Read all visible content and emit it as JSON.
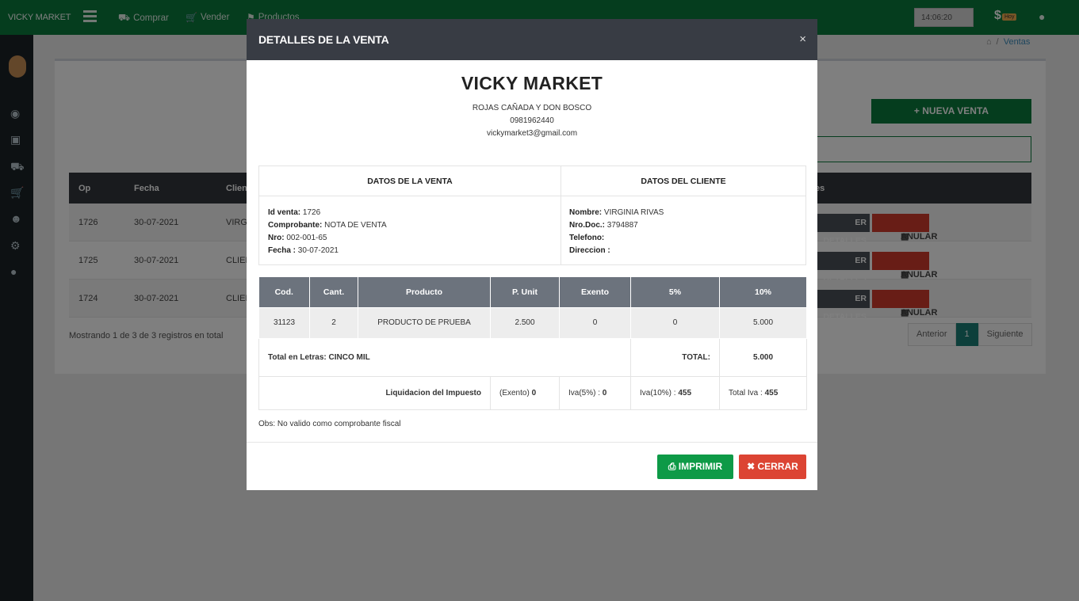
{
  "topbar": {
    "brand": "VICKY MARKET",
    "nav": [
      "Comprar",
      "Vender",
      "Productos"
    ],
    "clock": "14:06:20",
    "money_symbol": "$",
    "hoy": "Hoy"
  },
  "breadcrumb": {
    "current": "Ventas",
    "separator": "/"
  },
  "page": {
    "new_button": "NUEVA VENTA",
    "columns": [
      "Op",
      "Fecha",
      "Clien",
      "es"
    ],
    "rows": [
      {
        "op": "1726",
        "fecha": "30-07-2021",
        "cliente": "VIRGI"
      },
      {
        "op": "1725",
        "fecha": "30-07-2021",
        "cliente": "CLIEN"
      },
      {
        "op": "1724",
        "fecha": "30-07-2021",
        "cliente": "CLIEN"
      }
    ],
    "ver_label": "ER DETALLES",
    "anular_label": "ANULAR",
    "showing": "Mostrando 1 de 3 de 3 registros en total",
    "pager": {
      "prev": "Anterior",
      "page": "1",
      "next": "Siguiente"
    }
  },
  "modal": {
    "title": "DETALLES DE LA VENTA",
    "close": "×",
    "store": {
      "name": "VICKY MARKET",
      "address": "ROJAS CAÑADA Y DON BOSCO",
      "phone": "0981962440",
      "email": "vickymarket3@gmail.com"
    },
    "sale": {
      "heading": "DATOS DE LA VENTA",
      "id_label": "Id venta:",
      "id": "1726",
      "comp_label": "Comprobante:",
      "comp": "NOTA DE VENTA",
      "nro_label": "Nro:",
      "nro": "002-001-65",
      "fecha_label": "Fecha :",
      "fecha": "30-07-2021"
    },
    "client": {
      "heading": "DATOS DEL CLIENTE",
      "nombre_label": "Nombre:",
      "nombre": "VIRGINIA RIVAS",
      "doc_label": "Nro.Doc.:",
      "doc": "3794887",
      "tel_label": "Telefono:",
      "tel": "",
      "dir_label": "Direccion :",
      "dir": ""
    },
    "items": {
      "headers": [
        "Cod.",
        "Cant.",
        "Producto",
        "P. Unit",
        "Exento",
        "5%",
        "10%"
      ],
      "rows": [
        {
          "cod": "31123",
          "cant": "2",
          "producto": "PRODUCTO DE PRUEBA",
          "punit": "2.500",
          "exento": "0",
          "c5": "0",
          "c10": "5.000"
        }
      ]
    },
    "totals": {
      "letras_label": "Total en Letras:",
      "letras": "CINCO MIL",
      "total_label": "TOTAL:",
      "total": "5.000"
    },
    "liquidacion": {
      "label": "Liquidacion del Impuesto",
      "exento_label": "(Exento)",
      "exento": "0",
      "iva5_label": "Iva(5%) :",
      "iva5": "0",
      "iva10_label": "Iva(10%) :",
      "iva10": "455",
      "total_label": "Total Iva :",
      "total": "455"
    },
    "obs": "Obs: No valido como comprobante fiscal",
    "print_button": "IMPRIMIR",
    "close_button": "CERRAR"
  }
}
